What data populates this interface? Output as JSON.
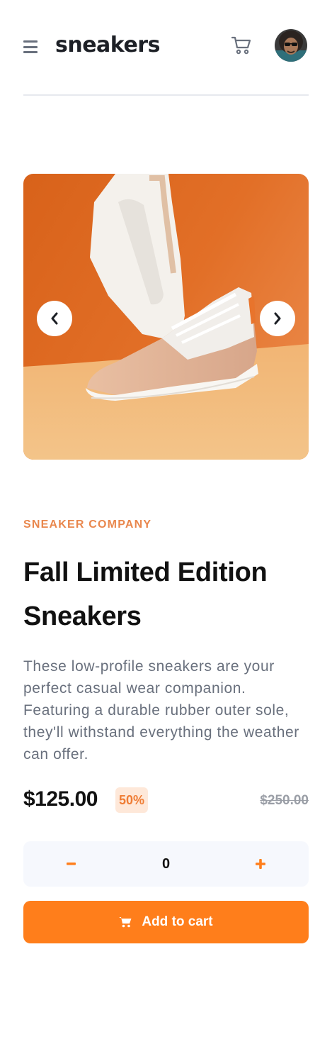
{
  "header": {
    "logo": "sneakers",
    "menu_icon": "hamburger-menu-icon",
    "cart_icon": "cart-icon",
    "avatar_icon": "user-avatar"
  },
  "gallery": {
    "prev_icon": "chevron-left-icon",
    "next_icon": "chevron-right-icon",
    "image": "sneaker-product-photo"
  },
  "product": {
    "company": "SNEAKER COMPANY",
    "title": "Fall Limited Edition Sneakers",
    "description": "These low-profile sneakers are your perfect casual wear companion. Featuring a durable rubber outer sole, they'll withstand everything the weather can offer.",
    "price": "$125.00",
    "discount": "50%",
    "original_price": "$250.00"
  },
  "quantity": {
    "minus_icon": "minus-icon",
    "value": "0",
    "plus_icon": "plus-icon"
  },
  "actions": {
    "add_to_cart_label": "Add to cart",
    "cart_icon": "cart-icon"
  },
  "colors": {
    "accent": "#ff7e1b",
    "accent_light": "#fee8d9",
    "text_dark": "#1d2026",
    "text_muted": "#69707d",
    "qty_bg": "#f6f8fd"
  }
}
